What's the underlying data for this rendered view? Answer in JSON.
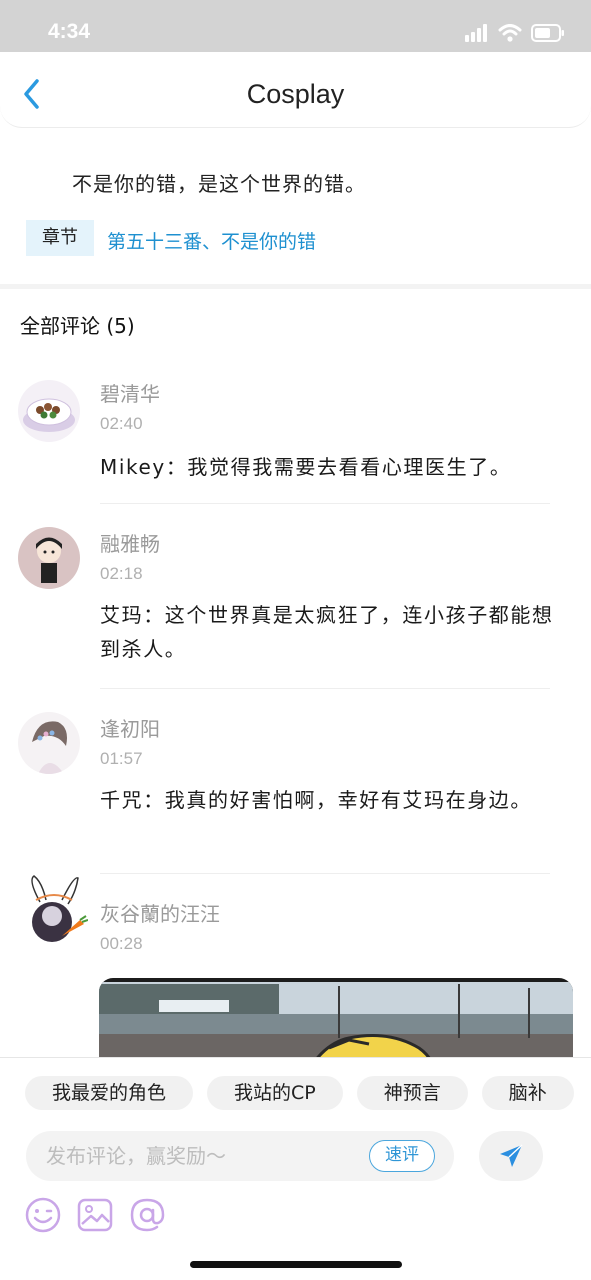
{
  "status_bar": {
    "time": "4:34"
  },
  "nav": {
    "title": "Cosplay"
  },
  "post": {
    "quote": "不是你的错，是这个世界的错。",
    "chapter_tag": "章节",
    "chapter_link": "第五十三番、不是你的错"
  },
  "comments": {
    "header": "全部评论 (5)",
    "items": [
      {
        "user": "碧清华",
        "time": "02:40",
        "text": "Mikey：我觉得我需要去看看心理医生了。"
      },
      {
        "user": "融雅畅",
        "time": "02:18",
        "text": "艾玛：这个世界真是太疯狂了，连小孩子都能想到杀人。"
      },
      {
        "user": "逢初阳",
        "time": "01:57",
        "text": "千咒：我真的好害怕啊，幸好有艾玛在身边。"
      },
      {
        "user": "灰谷蘭的汪汪",
        "time": "00:28"
      }
    ]
  },
  "quick_tags": [
    "我最爱的角色",
    "我站的CP",
    "神预言",
    "脑补"
  ],
  "composer": {
    "placeholder": "发布评论，赢奖励～",
    "quick_review": "速评"
  },
  "colors": {
    "accent": "#1e90d0",
    "status_bar": "#d3d3d3",
    "tag_bg": "#e4f3fb",
    "tool_icons": "#c9a6e8"
  },
  "icons": [
    "back-chevron-icon",
    "signal-icon",
    "wifi-icon",
    "battery-icon",
    "send-icon",
    "emoji-icon",
    "image-icon",
    "mention-icon"
  ]
}
